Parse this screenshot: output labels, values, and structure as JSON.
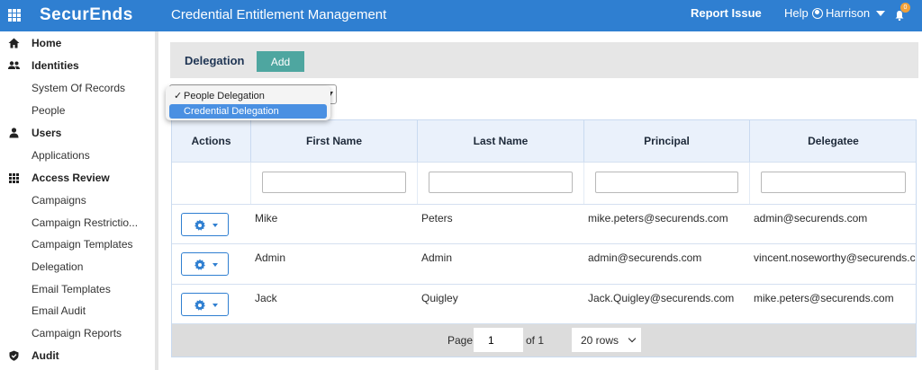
{
  "topbar": {
    "brand": "SecurEnds",
    "title": "Credential Entitlement Management",
    "report_issue": "Report Issue",
    "help": "Help",
    "user_name": "Harrison",
    "notification_count": "0",
    "bg_color": "#2f7fd1"
  },
  "sidebar": {
    "items": [
      {
        "label": "Home",
        "icon": "home-icon",
        "section": true
      },
      {
        "label": "Identities",
        "icon": "people-icon",
        "section": true
      },
      {
        "label": "System Of Records",
        "section": false
      },
      {
        "label": "People",
        "section": false
      },
      {
        "label": "Users",
        "icon": "user-icon",
        "section": true
      },
      {
        "label": "Applications",
        "section": false
      },
      {
        "label": "Access Review",
        "icon": "grid-icon",
        "section": true
      },
      {
        "label": "Campaigns",
        "section": false
      },
      {
        "label": "Campaign Restrictio...",
        "section": false
      },
      {
        "label": "Campaign Templates",
        "section": false
      },
      {
        "label": "Delegation",
        "section": false
      },
      {
        "label": "Email Templates",
        "section": false
      },
      {
        "label": "Email Audit",
        "section": false
      },
      {
        "label": "Campaign Reports",
        "section": false
      },
      {
        "label": "Audit",
        "icon": "shield-icon",
        "section": true
      }
    ]
  },
  "page": {
    "title": "Delegation",
    "add_label": "Add",
    "add_color": "#4ea6a0"
  },
  "delegation_type": {
    "options": [
      "People Delegation",
      "Credential Delegation"
    ],
    "checked": "People Delegation",
    "highlighted": "Credential Delegation",
    "check_mark": "✓"
  },
  "table": {
    "columns": [
      "Actions",
      "First Name",
      "Last Name",
      "Principal",
      "Delegatee"
    ],
    "rows": [
      {
        "first": "Mike",
        "last": "Peters",
        "principal": "mike.peters@securends.com",
        "delegatee": "admin@securends.com"
      },
      {
        "first": "Admin",
        "last": "Admin",
        "principal": "admin@securends.com",
        "delegatee": "vincent.noseworthy@securends.com"
      },
      {
        "first": "Jack",
        "last": "Quigley",
        "principal": "Jack.Quigley@securends.com",
        "delegatee": "mike.peters@securends.com"
      }
    ]
  },
  "pager": {
    "page_label": "Page",
    "page_value": "1",
    "of_label": "of 1",
    "page_size": "20 rows"
  }
}
